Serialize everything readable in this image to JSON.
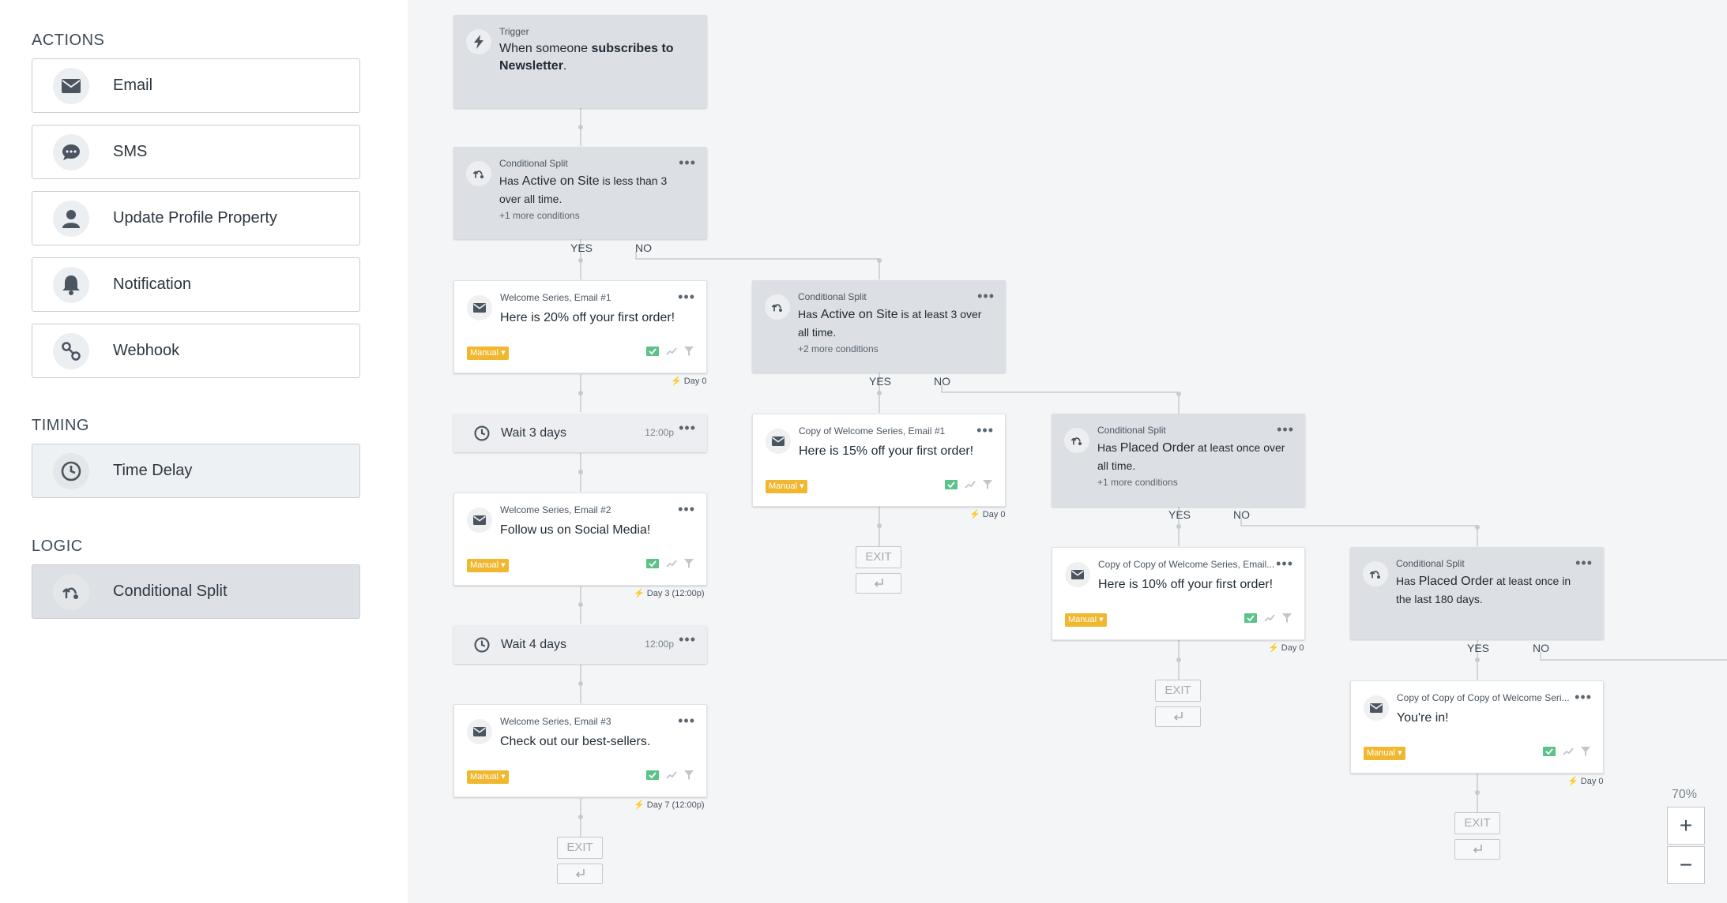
{
  "sidebar": {
    "sections": [
      {
        "title": "ACTIONS"
      },
      {
        "title": "TIMING"
      },
      {
        "title": "LOGIC"
      }
    ],
    "items": [
      {
        "label": "Email",
        "icon": "envelope-icon"
      },
      {
        "label": "SMS",
        "icon": "chat-bubble-icon"
      },
      {
        "label": "Update Profile Property",
        "icon": "person-icon"
      },
      {
        "label": "Notification",
        "icon": "bell-icon"
      },
      {
        "label": "Webhook",
        "icon": "webhook-icon"
      },
      {
        "label": "Time Delay",
        "icon": "clock-icon"
      },
      {
        "label": "Conditional Split",
        "icon": "split-icon"
      }
    ]
  },
  "flow": {
    "trigger": {
      "sub": "Trigger",
      "pre": "When someone ",
      "bold1": "subscribes to",
      "bold2": "Newsletter",
      "post": "."
    },
    "splits": [
      {
        "sub": "Conditional Split",
        "pre": "Has ",
        "metric": "Active on Site",
        "line1": " is less than 3",
        "line2": "over all time.",
        "more": "+1 more conditions"
      },
      {
        "sub": "Conditional Split",
        "pre": "Has ",
        "metric": "Active on Site",
        "line1": " is at least 3 over",
        "line2": "all time.",
        "more": "+2 more conditions"
      },
      {
        "sub": "Conditional Split",
        "pre": "Has ",
        "metric": "Placed Order",
        "line1": " at least once over",
        "line2": "all time.",
        "more": "+1 more conditions"
      },
      {
        "sub": "Conditional Split",
        "pre": "Has ",
        "metric": "Placed Order",
        "line1": " at least once in",
        "line2": "the last 180 days.",
        "more": ""
      }
    ],
    "emails": [
      {
        "sub": "Welcome Series, Email #1",
        "title": "Here is 20% off your first order!",
        "status": "Manual",
        "day": "Day 0"
      },
      {
        "sub": "Welcome Series, Email #2",
        "title": "Follow us on Social Media!",
        "status": "Manual",
        "day": "Day 3 (12:00p)"
      },
      {
        "sub": "Welcome Series, Email #3",
        "title": "Check out our best-sellers.",
        "status": "Manual",
        "day": "Day 7 (12:00p)"
      },
      {
        "sub": "Copy of Welcome Series, Email #1",
        "title": "Here is 15% off your first order!",
        "status": "Manual",
        "day": "Day 0"
      },
      {
        "sub": "Copy of Copy of Welcome Series, Email...",
        "title": "Here is 10% off your first order!",
        "status": "Manual",
        "day": "Day 0"
      },
      {
        "sub": "Copy of Copy of Copy of Welcome Seri...",
        "title": "You're in!",
        "status": "Manual",
        "day": "Day 0"
      }
    ],
    "waits": [
      {
        "label": "Wait 3 days",
        "time": "12:00p"
      },
      {
        "label": "Wait 4 days",
        "time": "12:00p"
      }
    ],
    "yes": "YES",
    "no": "NO",
    "exit": "EXIT"
  },
  "zoom": {
    "level": "70%",
    "plus": "+",
    "minus": "−"
  },
  "colors": {
    "manual_badge": "#f0b72f",
    "split_bg": "#dcdfe4",
    "stat_green": "#5cc28a"
  }
}
